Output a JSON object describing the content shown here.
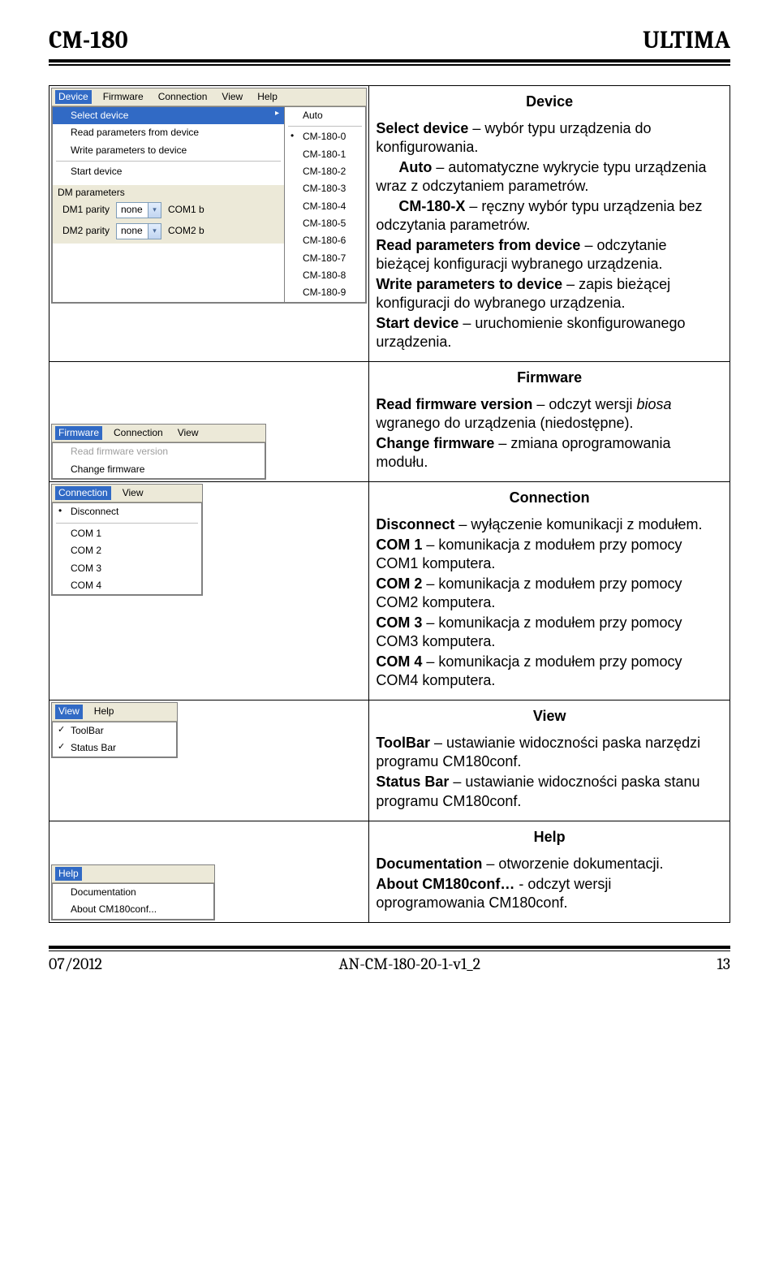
{
  "header": {
    "left": "CM-180",
    "right": "ULTIMA"
  },
  "footer": {
    "left": "07/2012",
    "center": "AN-CM-180-20-1-v1_2",
    "right": "13"
  },
  "shot1": {
    "menubar": [
      "Device",
      "Firmware",
      "Connection",
      "View",
      "Help"
    ],
    "drop": {
      "items": [
        {
          "label": "Select device",
          "selected": true,
          "arrow": true
        },
        {
          "label": "Read parameters from device"
        },
        {
          "label": "Write parameters to device"
        },
        {
          "sep": true
        },
        {
          "label": "Start device"
        }
      ]
    },
    "sidedrop": [
      "Auto",
      "CM-180-0",
      "CM-180-1",
      "CM-180-2",
      "CM-180-3",
      "CM-180-4",
      "CM-180-5",
      "CM-180-6",
      "CM-180-7",
      "CM-180-8",
      "CM-180-9"
    ],
    "bottom": {
      "plabel": "DM parameters",
      "p1": {
        "label": "DM1 parity",
        "value": "none",
        "right": "COM1 b"
      },
      "p2": {
        "label": "DM2 parity",
        "value": "none",
        "right": "COM2 b"
      }
    }
  },
  "shot2": {
    "menubar": [
      "Firmware",
      "Connection",
      "View"
    ],
    "items": [
      {
        "label": "Read firmware version",
        "disabled": true
      },
      {
        "label": "Change firmware"
      }
    ]
  },
  "shot3": {
    "menubar": [
      "Connection",
      "View"
    ],
    "items": [
      {
        "label": "Disconnect",
        "bullet": true
      },
      {
        "sep": true
      },
      {
        "label": "COM 1"
      },
      {
        "label": "COM 2"
      },
      {
        "label": "COM 3"
      },
      {
        "label": "COM 4"
      }
    ]
  },
  "shot4": {
    "menubar": [
      "View",
      "Help"
    ],
    "items": [
      {
        "label": "ToolBar",
        "check": true
      },
      {
        "label": "Status Bar",
        "check": true
      }
    ]
  },
  "shot5": {
    "menubar": [
      "Help"
    ],
    "items": [
      {
        "label": "Documentation"
      },
      {
        "label": "About CM180conf..."
      }
    ]
  },
  "desc": {
    "device": {
      "title": "Device",
      "p1a": "Select device",
      "p1b": " – wybór typu urządzenia do konfigurowania.",
      "p2a": "Auto",
      "p2b": " – automatyczne wykrycie typu urządzenia wraz z odczytaniem parametrów.",
      "p3a": "CM-180-X",
      "p3b": " – ręczny wybór typu urządzenia bez odczytania parametrów.",
      "p4a": "Read parameters from device",
      "p4b": " – odczytanie bieżącej konfiguracji wybranego urządzenia.",
      "p5a": "Write parameters to device",
      "p5b": " – zapis bieżącej konfiguracji do wybranego urządzenia.",
      "p6a": "Start device",
      "p6b": " – uruchomienie skonfigurowanego urządzenia."
    },
    "firmware": {
      "title": "Firmware",
      "p1a": "Read firmware version",
      "p1b": " – odczyt wersji ",
      "p1c": "biosa",
      "p1d": " wgranego do urządzenia (niedostępne).",
      "p2a": "Change firmware",
      "p2b": " – zmiana oprogramowania modułu."
    },
    "connection": {
      "title": "Connection",
      "p1a": "Disconnect",
      "p1b": " – wyłączenie komunikacji z modułem.",
      "p2a": "COM 1",
      "p2b": " – komunikacja z modułem przy pomocy COM1 komputera.",
      "p3a": "COM 2",
      "p3b": " – komunikacja z modułem przy pomocy COM2 komputera.",
      "p4a": "COM 3",
      "p4b": " – komunikacja z modułem przy pomocy COM3 komputera.",
      "p5a": "COM 4",
      "p5b": " – komunikacja z modułem przy pomocy COM4 komputera."
    },
    "view": {
      "title": "View",
      "p1a": "ToolBar",
      "p1b": " – ustawianie widoczności paska narzędzi programu CM180conf.",
      "p2a": " Status Bar",
      "p2b": " – ustawianie widoczności paska stanu programu CM180conf."
    },
    "help": {
      "title": "Help",
      "p1a": "Documentation",
      "p1b": " – otworzenie dokumentacji.",
      "p2a": "About CM180conf…",
      "p2b": " - odczyt wersji oprogramowania CM180conf."
    }
  }
}
